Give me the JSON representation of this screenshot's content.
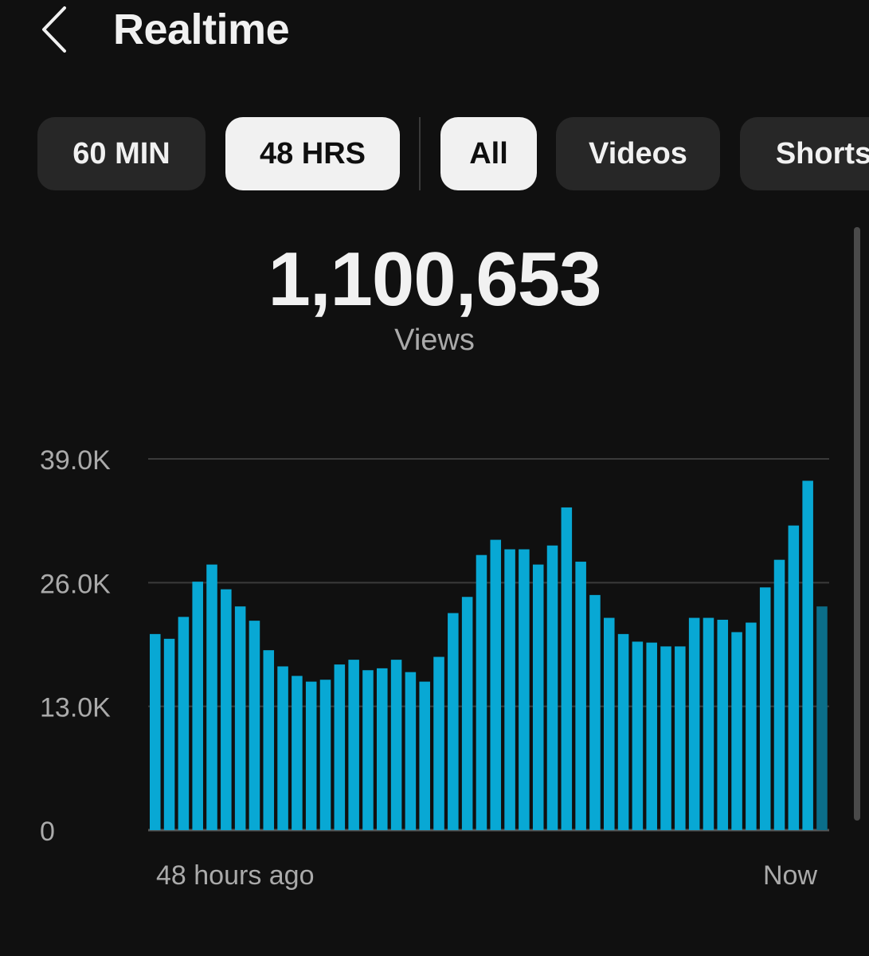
{
  "header": {
    "title": "Realtime",
    "back_icon": "chevron-left-icon"
  },
  "chips": {
    "time_ranges": [
      {
        "label": "60 MIN",
        "selected": false
      },
      {
        "label": "48 HRS",
        "selected": true
      }
    ],
    "content_types": [
      {
        "label": "All",
        "selected": true
      },
      {
        "label": "Videos",
        "selected": false
      },
      {
        "label": "Shorts",
        "selected": false
      }
    ]
  },
  "summary": {
    "total": "1,100,653",
    "label": "Views"
  },
  "colors": {
    "background": "#101010",
    "bar": "#08a8d4",
    "bar_current": "#0b6e8a",
    "gridline": "#3a3a3a",
    "chip_bg": "#272727",
    "chip_selected_bg": "#f1f1f1"
  },
  "chart_data": {
    "type": "bar",
    "title": "",
    "xlabel": "",
    "ylabel": "",
    "ylim": [
      0,
      39000
    ],
    "y_ticks": [
      0,
      13000,
      26000,
      39000
    ],
    "y_tick_labels": [
      "0",
      "13.0K",
      "26.0K",
      "39.0K"
    ],
    "x_start_label": "48 hours ago",
    "x_end_label": "Now",
    "grid": true,
    "values": [
      20600,
      20100,
      22400,
      26100,
      27900,
      25300,
      23500,
      22000,
      18900,
      17200,
      16200,
      15600,
      15800,
      17400,
      17900,
      16800,
      17000,
      17900,
      16600,
      15600,
      18200,
      22800,
      24500,
      28900,
      30500,
      29500,
      29500,
      27900,
      29900,
      33900,
      28200,
      24700,
      22300,
      20600,
      19800,
      19700,
      19300,
      19300,
      22300,
      22300,
      22100,
      20800,
      21800,
      25500,
      28400,
      32000,
      36700,
      23500
    ],
    "current_partial_index": 47
  }
}
